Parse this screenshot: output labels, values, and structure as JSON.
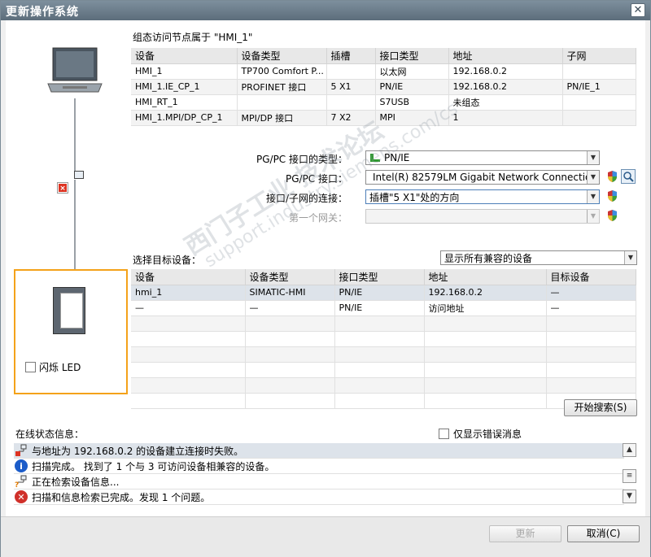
{
  "window": {
    "title": "更新操作系统"
  },
  "access_node": {
    "label": "组态访问节点属于 \"HMI_1\"",
    "columns": [
      "设备",
      "设备类型",
      "插槽",
      "接口类型",
      "地址",
      "子网"
    ],
    "rows": [
      [
        "HMI_1",
        "TP700 Comfort P...",
        "",
        "以太网",
        "192.168.0.2",
        ""
      ],
      [
        "HMI_1.IE_CP_1",
        "PROFINET 接口",
        "5 X1",
        "PN/IE",
        "192.168.0.2",
        "PN/IE_1"
      ],
      [
        "HMI_RT_1",
        "",
        "",
        "S7USB",
        "未组态",
        ""
      ],
      [
        "HMI_1.MPI/DP_CP_1",
        "MPI/DP 接口",
        "7 X2",
        "MPI",
        "1",
        ""
      ]
    ]
  },
  "form": {
    "pgpc_type_label": "PG/PC 接口的类型：",
    "pgpc_type_value": "PN/IE",
    "pgpc_iface_label": "PG/PC 接口：",
    "pgpc_iface_value": "Intel(R) 82579LM Gigabit Network Connection",
    "conn_label": "接口/子网的连接：",
    "conn_value": "插槽\"5 X1\"处的方向",
    "gateway_label": "第一个网关：",
    "gateway_value": ""
  },
  "target": {
    "label": "选择目标设备：",
    "filter_value": "显示所有兼容的设备",
    "columns": [
      "设备",
      "设备类型",
      "接口类型",
      "地址",
      "目标设备"
    ],
    "rows": [
      [
        "hmi_1",
        "SIMATIC-HMI",
        "PN/IE",
        "192.168.0.2",
        "—"
      ],
      [
        "—",
        "—",
        "PN/IE",
        "访问地址",
        "—"
      ]
    ]
  },
  "led": {
    "label": "闪烁 LED"
  },
  "search_button": "开始搜索(S)",
  "status": {
    "label": "在线状态信息：",
    "errors_only_label": "仅显示错误消息",
    "messages": [
      {
        "icon": "connection-error-icon",
        "text": "与地址为 192.168.0.2 的设备建立连接时失败。"
      },
      {
        "icon": "info-icon",
        "text": "扫描完成。 找到了 1 个与 3 可访问设备相兼容的设备。"
      },
      {
        "icon": "searching-icon",
        "text": "正在检索设备信息..."
      },
      {
        "icon": "error-icon",
        "text": "扫描和信息检索已完成。发现 1 个问题。"
      }
    ]
  },
  "footer": {
    "update_label": "更新",
    "cancel_label": "取消(C)"
  },
  "watermark": {
    "line1": "西门子工业 技术论坛",
    "line2": "support.industry.siemens.com/cs"
  },
  "colors": {
    "highlight_border": "#f4a21a",
    "titlebar": "#6b7c8a",
    "selection": "#dde3ea"
  }
}
